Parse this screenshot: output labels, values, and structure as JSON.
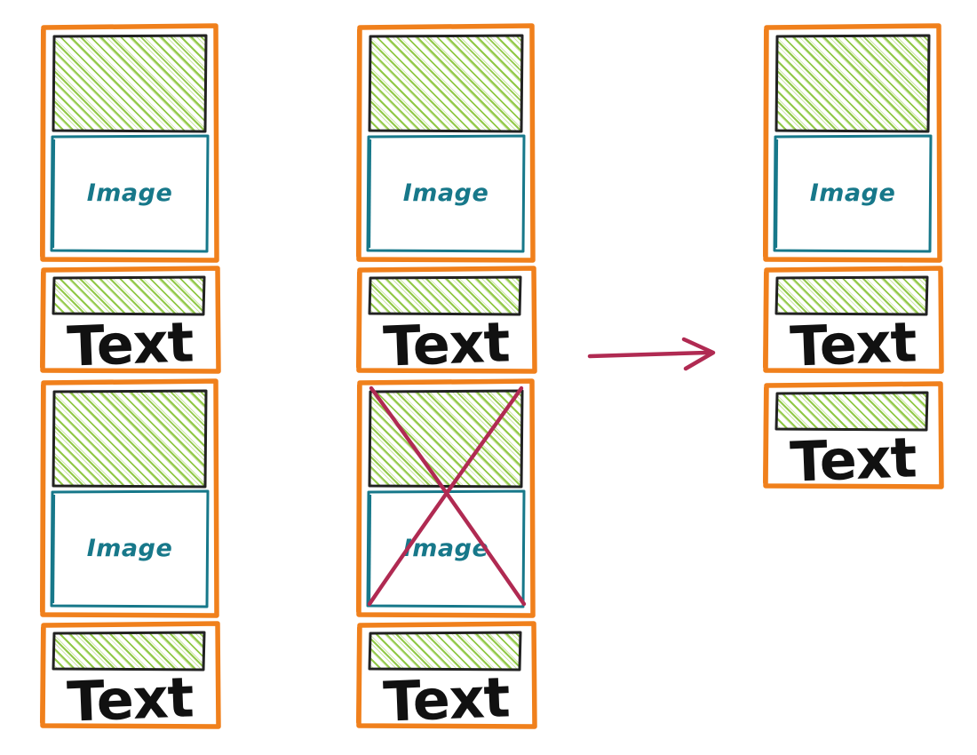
{
  "diagram": {
    "title": "Image and text card list transformation",
    "colors": {
      "card_border": "#f0801c",
      "hatch_green": "#8cc63f",
      "image_frame_teal": "#17788a",
      "image_label_teal": "#17788a",
      "text_black": "#111111",
      "crossout_crimson": "#b02a52",
      "arrow_crimson": "#b02a52",
      "background": "#ffffff"
    },
    "labels": {
      "image": "Image",
      "text": "Text"
    },
    "columns": [
      {
        "id": "left-column",
        "name": "source-list-left",
        "cards": [
          {
            "id": "l1",
            "type": "image",
            "label": "Image",
            "crossed_out": false
          },
          {
            "id": "l2",
            "type": "text",
            "label": "Text",
            "crossed_out": false
          },
          {
            "id": "l3",
            "type": "image",
            "label": "Image",
            "crossed_out": false
          },
          {
            "id": "l4",
            "type": "text",
            "label": "Text",
            "crossed_out": false
          }
        ]
      },
      {
        "id": "middle-column",
        "name": "marked-list-middle",
        "cards": [
          {
            "id": "m1",
            "type": "image",
            "label": "Image",
            "crossed_out": false
          },
          {
            "id": "m2",
            "type": "text",
            "label": "Text",
            "crossed_out": false
          },
          {
            "id": "m3",
            "type": "image",
            "label": "Image",
            "crossed_out": true
          },
          {
            "id": "m4",
            "type": "text",
            "label": "Text",
            "crossed_out": false
          }
        ]
      },
      {
        "id": "right-column",
        "name": "result-list-right",
        "cards": [
          {
            "id": "r1",
            "type": "image",
            "label": "Image",
            "crossed_out": false
          },
          {
            "id": "r2",
            "type": "text",
            "label": "Text",
            "crossed_out": false
          },
          {
            "id": "r3",
            "type": "text",
            "label": "Text",
            "crossed_out": false
          }
        ]
      }
    ],
    "arrow": {
      "id": "transform-arrow",
      "direction": "right",
      "color": "#b02a52"
    }
  }
}
